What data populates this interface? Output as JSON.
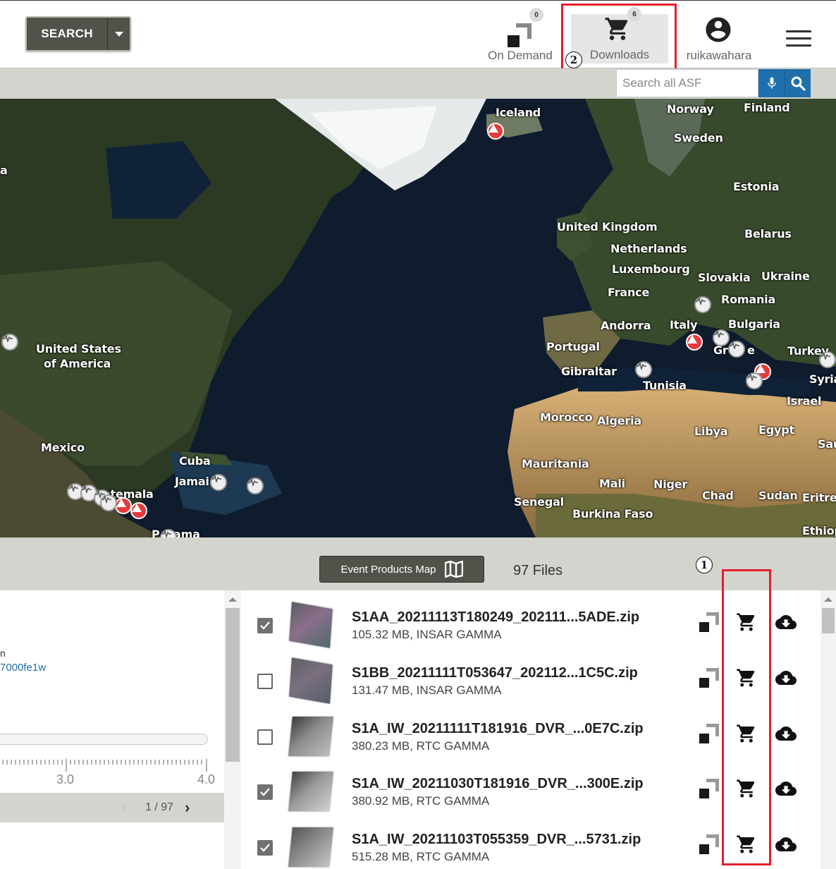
{
  "header": {
    "search_button_label": "SEARCH",
    "on_demand": {
      "label": "On Demand",
      "count": "0"
    },
    "downloads": {
      "label": "Downloads",
      "count": "6"
    },
    "user": {
      "label": "ruikawahara"
    }
  },
  "annotations": {
    "marker_1": "1",
    "marker_2": "2"
  },
  "site_search": {
    "placeholder": "Search all ASF"
  },
  "map_labels": [
    "Iceland",
    "Norway",
    "Finland",
    "Sweden",
    "Estonia",
    "United Kingdom",
    "Belarus",
    "Netherlands",
    "Luxembourg",
    "Slovakia",
    "Ukraine",
    "France",
    "Romania",
    "Andorra",
    "Italy",
    "Bulgaria",
    "Portugal",
    "Gre",
    "e",
    "Turkey",
    "Gibraltar",
    "Syria",
    "Tunisia",
    "Israel",
    "United States",
    "of America",
    "Morocco",
    "Algeria",
    "Libya",
    "Egypt",
    "Sau",
    "Mexico",
    "Cuba",
    "Jamai",
    "Mauritania",
    "Mali",
    "Niger",
    "Chad",
    "Sudan",
    "Eritre",
    "Senegal",
    "atemala",
    "Burkina Faso",
    "Ethiop",
    "P",
    "ama",
    "a"
  ],
  "results": {
    "event_map_button": "Event Products Map",
    "files_count": "97 Files"
  },
  "left_panel": {
    "text_fragment_1": "n",
    "link_fragment": "7000fe1w",
    "tick_3": "3.0",
    "tick_4": "4.0",
    "pager": "1 / 97"
  },
  "files": [
    {
      "name": "S1AA_20211113T180249_202111...5ADE.zip",
      "meta": "105.32 MB, INSAR GAMMA",
      "checked": true
    },
    {
      "name": "S1BB_20211111T053647_202112...1C5C.zip",
      "meta": "131.47 MB, INSAR GAMMA",
      "checked": false
    },
    {
      "name": "S1A_IW_20211111T181916_DVR_...0E7C.zip",
      "meta": "380.23 MB, RTC GAMMA",
      "checked": false
    },
    {
      "name": "S1A_IW_20211030T181916_DVR_...300E.zip",
      "meta": "380.92 MB, RTC GAMMA",
      "checked": true
    },
    {
      "name": "S1A_IW_20211103T055359_DVR_...5731.zip",
      "meta": "515.28 MB, RTC GAMMA",
      "checked": true
    }
  ],
  "colors": {
    "accent_blue": "#1f6fad",
    "highlight_red": "#e31e2d",
    "button_dark": "#50534a"
  }
}
